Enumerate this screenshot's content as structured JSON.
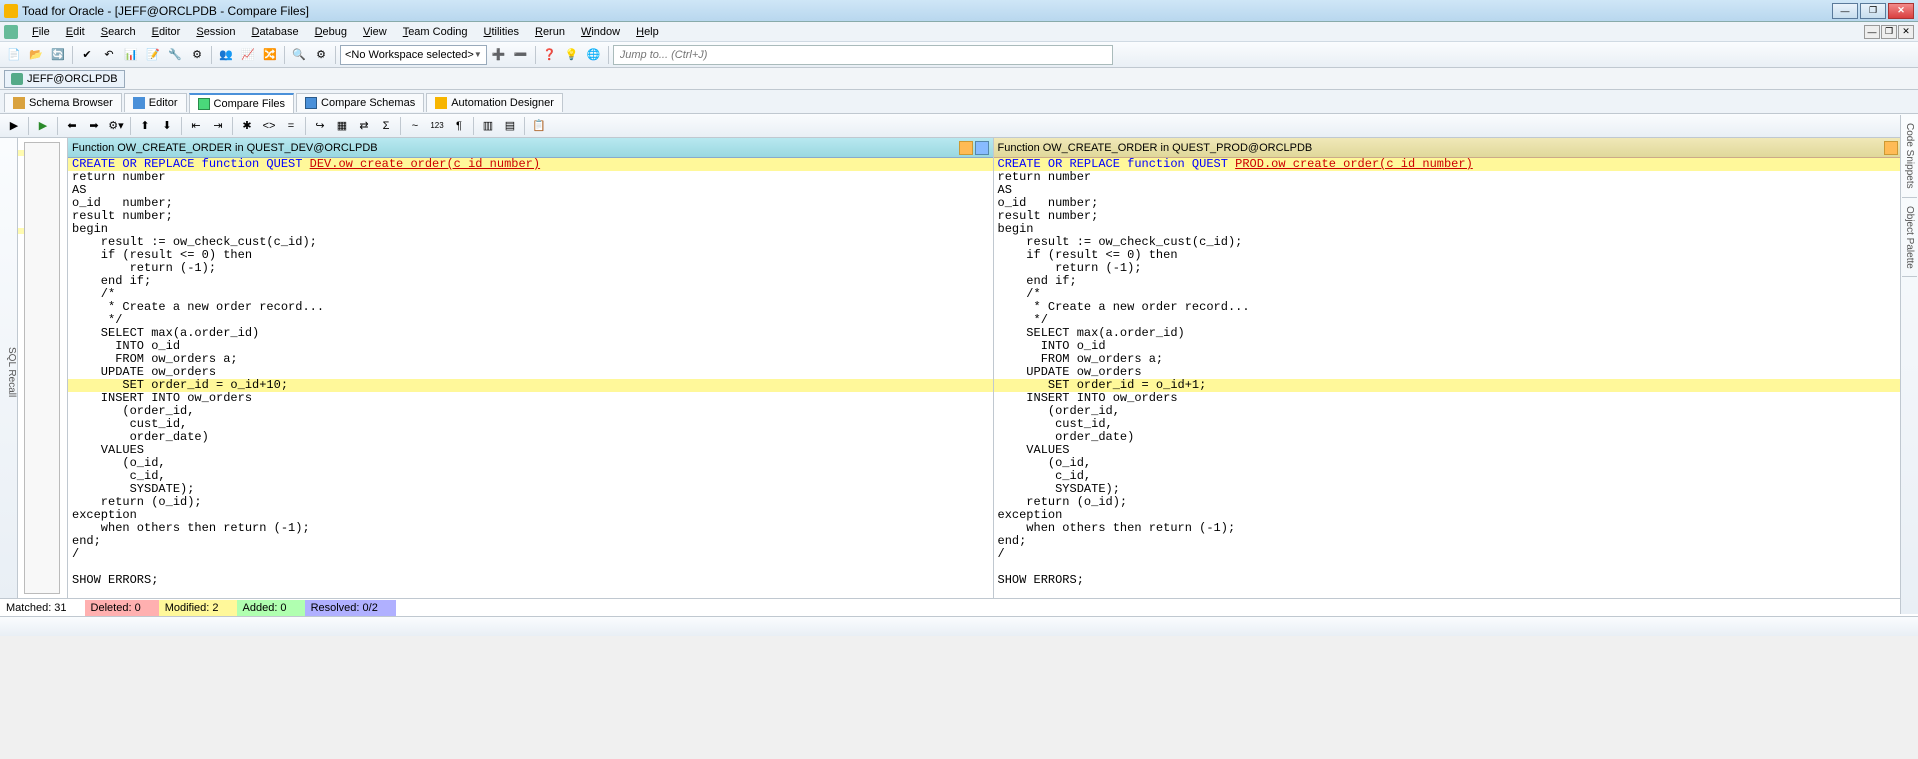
{
  "window": {
    "title": "Toad for Oracle - [JEFF@ORCLPDB - Compare Files]"
  },
  "menu": {
    "items": [
      "File",
      "Edit",
      "Search",
      "Editor",
      "Session",
      "Database",
      "Debug",
      "View",
      "Team Coding",
      "Utilities",
      "Rerun",
      "Window",
      "Help"
    ]
  },
  "workspace_combo": "<No Workspace selected>",
  "jump_placeholder": "Jump to... (Ctrl+J)",
  "connection": "JEFF@ORCLPDB",
  "tabs": [
    {
      "label": "Schema Browser",
      "icon": "ti-schema"
    },
    {
      "label": "Editor",
      "icon": "ti-editor"
    },
    {
      "label": "Compare Files",
      "icon": "ti-cmp",
      "active": true
    },
    {
      "label": "Compare Schemas",
      "icon": "ti-cmps"
    },
    {
      "label": "Automation Designer",
      "icon": "ti-auto"
    }
  ],
  "left_rail": "SQL Recall",
  "right_rails": [
    "Code Snippets",
    "Object Palette"
  ],
  "pane_left": {
    "header": "Function OW_CREATE_ORDER in QUEST_DEV@ORCLPDB",
    "diff_header_prefix": "CREATE OR REPLACE function QUEST ",
    "diff_header_red": "DEV.ow create order(c id number)",
    "lines": [
      "return number",
      "AS",
      "o_id   number;",
      "result number;",
      "begin",
      "    result := ow_check_cust(c_id);",
      "    if (result <= 0) then",
      "        return (-1);",
      "    end if;",
      "    /*",
      "     * Create a new order record...",
      "     */",
      "    SELECT max(a.order_id)",
      "      INTO o_id",
      "      FROM ow_orders a;",
      "    UPDATE ow_orders"
    ],
    "diff_line": "       SET order_id = o_id+10;",
    "lines2": [
      "    INSERT INTO ow_orders",
      "       (order_id,",
      "        cust_id,",
      "        order_date)",
      "    VALUES",
      "       (o_id,",
      "        c_id,",
      "        SYSDATE);",
      "    return (o_id);",
      "exception",
      "    when others then return (-1);",
      "end;",
      "/",
      "",
      "SHOW ERRORS;"
    ]
  },
  "pane_right": {
    "header": "Function OW_CREATE_ORDER in QUEST_PROD@ORCLPDB",
    "diff_header_prefix": "CREATE OR REPLACE function QUEST ",
    "diff_header_red": "PROD.ow create order(c id number)",
    "lines": [
      "return number",
      "AS",
      "o_id   number;",
      "result number;",
      "begin",
      "    result := ow_check_cust(c_id);",
      "    if (result <= 0) then",
      "        return (-1);",
      "    end if;",
      "    /*",
      "     * Create a new order record...",
      "     */",
      "    SELECT max(a.order_id)",
      "      INTO o_id",
      "      FROM ow_orders a;",
      "    UPDATE ow_orders"
    ],
    "diff_line": "       SET order_id = o_id+1;",
    "lines2": [
      "    INSERT INTO ow_orders",
      "       (order_id,",
      "        cust_id,",
      "        order_date)",
      "    VALUES",
      "       (o_id,",
      "        c_id,",
      "        SYSDATE);",
      "    return (o_id);",
      "exception",
      "    when others then return (-1);",
      "end;",
      "/",
      "",
      "SHOW ERRORS;"
    ]
  },
  "diff_status": {
    "matched": "Matched: 31",
    "deleted": "Deleted: 0",
    "modified": "Modified: 2",
    "added": "Added: 0",
    "resolved": "Resolved: 0/2"
  }
}
